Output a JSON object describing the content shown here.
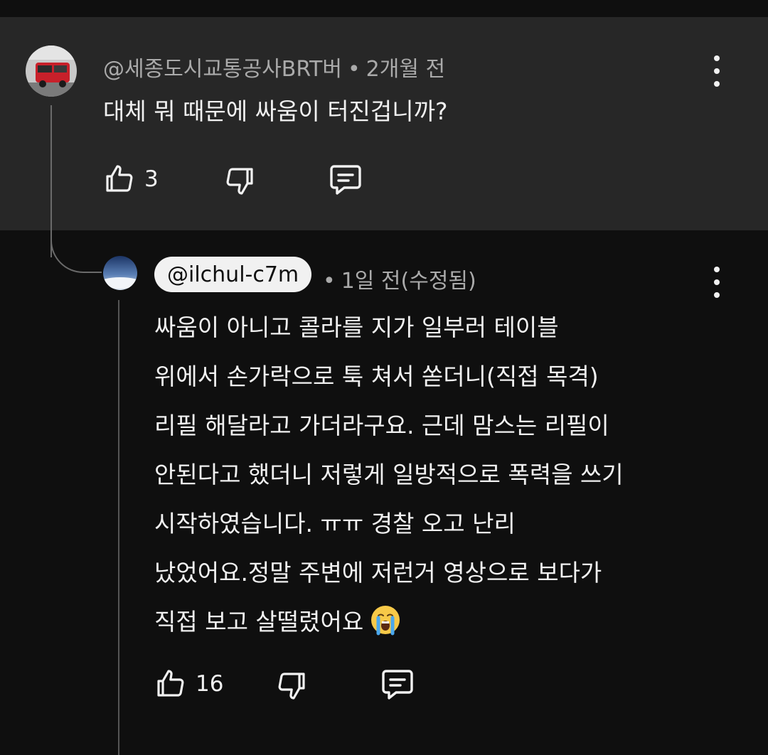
{
  "parent_comment": {
    "author": "@세종도시교통공사BRT버",
    "time": "2개월 전",
    "separator": "•",
    "text": "대체 뭐 때문에 싸움이 터진겁니까?",
    "like_count": "3",
    "avatar_icon": "bus-photo-avatar"
  },
  "reply_comment": {
    "author": "@ilchul-c7m",
    "time": "1일 전(수정됨)",
    "separator": "•",
    "lines": [
      "싸움이 아니고 콜라를 지가 일부러 테이블",
      "위에서 손가락으로 툭 쳐서 쏟더니(직접 목격)",
      "리필 해달라고 가더라구요. 근데 맘스는 리필이",
      "안된다고 했더니 저렇게 일방적으로 폭력을 쓰기",
      "시작하였습니다.  ㅠㅠ 경찰 오고 난리",
      "났었어요.정말 주변에 저런거 영상으로 보다가",
      "직접 보고 살떨렸어요"
    ],
    "emoji": "crying-face-emoji",
    "like_count": "16",
    "avatar_icon": "sky-photo-avatar"
  },
  "colors": {
    "background": "#0f0f0f",
    "parent_highlight": "#272727",
    "text": "#f1f1f1",
    "meta": "#aaaaaa"
  }
}
